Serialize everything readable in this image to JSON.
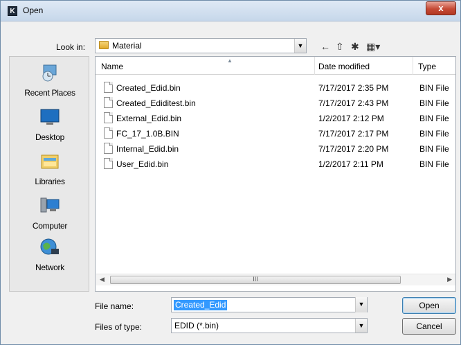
{
  "window": {
    "title": "Open",
    "app_icon_letter": "K",
    "close_glyph": "x"
  },
  "look_in": {
    "label": "Look in:",
    "value": "Material"
  },
  "nav_tools": [
    {
      "name": "back-arrow-icon",
      "glyph": "←"
    },
    {
      "name": "up-folder-icon",
      "glyph": "⇧"
    },
    {
      "name": "new-folder-icon",
      "glyph": "✱"
    },
    {
      "name": "view-menu-icon",
      "glyph": "▦▾"
    }
  ],
  "places": [
    {
      "label": "Recent Places",
      "icon": "recent-places-icon"
    },
    {
      "label": "Desktop",
      "icon": "desktop-icon"
    },
    {
      "label": "Libraries",
      "icon": "libraries-icon"
    },
    {
      "label": "Computer",
      "icon": "computer-icon"
    },
    {
      "label": "Network",
      "icon": "network-icon"
    }
  ],
  "file_list": {
    "columns": [
      "Name",
      "Date modified",
      "Type"
    ],
    "rows": [
      {
        "name": "Created_Edid.bin",
        "date": "7/17/2017 2:35 PM",
        "type": "BIN File"
      },
      {
        "name": "Created_Ediditest.bin",
        "date": "7/17/2017 2:43 PM",
        "type": "BIN File"
      },
      {
        "name": "External_Edid.bin",
        "date": "1/2/2017 2:12 PM",
        "type": "BIN File"
      },
      {
        "name": "FC_17_1.0B.BIN",
        "date": "7/17/2017 2:17 PM",
        "type": "BIN File"
      },
      {
        "name": "Internal_Edid.bin",
        "date": "7/17/2017 2:20 PM",
        "type": "BIN File"
      },
      {
        "name": "User_Edid.bin",
        "date": "1/2/2017 2:11 PM",
        "type": "BIN File"
      }
    ],
    "scroll_thumb_glyph": "III"
  },
  "file_name": {
    "label": "File name:",
    "value": "Created_Edid"
  },
  "file_type": {
    "label": "Files of type:",
    "value": "EDID (*.bin)"
  },
  "buttons": {
    "open": "Open",
    "cancel": "Cancel"
  }
}
